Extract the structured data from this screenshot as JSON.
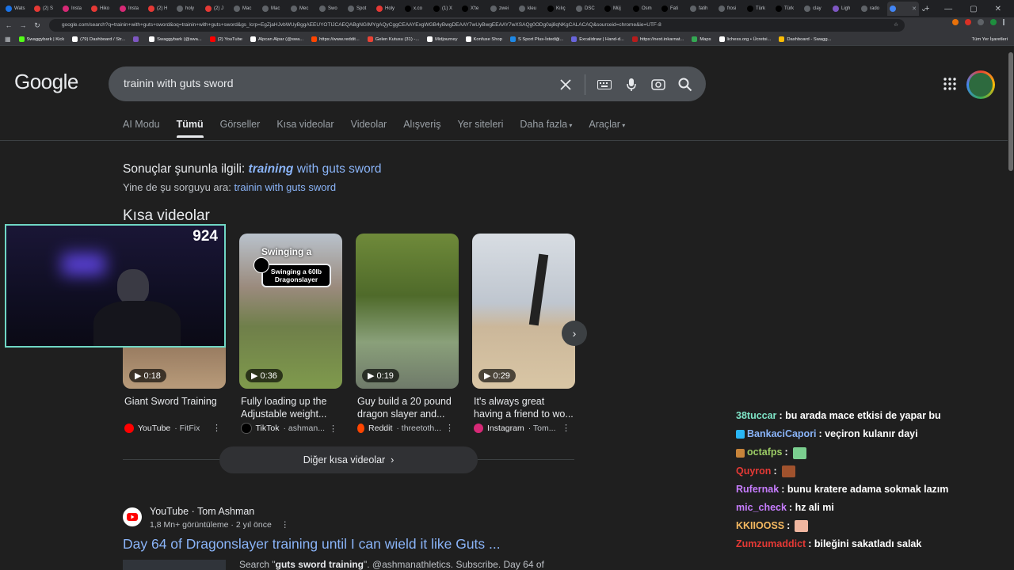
{
  "browser": {
    "tabs": [
      {
        "label": "Wats",
        "color": "#1a73e8"
      },
      {
        "label": "(2) S",
        "color": "#e53935"
      },
      {
        "label": "Insta",
        "color": "#d62976"
      },
      {
        "label": "Hiko",
        "color": "#e53935"
      },
      {
        "label": "Insta",
        "color": "#d62976"
      },
      {
        "label": "(2) H",
        "color": "#e53935"
      },
      {
        "label": "holy",
        "color": "#5f6368"
      },
      {
        "label": "(2) J",
        "color": "#e53935"
      },
      {
        "label": "Mac",
        "color": "#5f6368"
      },
      {
        "label": "Mac",
        "color": "#5f6368"
      },
      {
        "label": "Mec",
        "color": "#5f6368"
      },
      {
        "label": "Swo",
        "color": "#5f6368"
      },
      {
        "label": "Spot",
        "color": "#5f6368"
      },
      {
        "label": "Holy",
        "color": "#e53935"
      },
      {
        "label": "x.co",
        "color": "#000000"
      },
      {
        "label": "(1) X",
        "color": "#000000"
      },
      {
        "label": "X'te",
        "color": "#000000"
      },
      {
        "label": "zwei",
        "color": "#5f6368"
      },
      {
        "label": "kleu",
        "color": "#5f6368"
      },
      {
        "label": "Kılıç",
        "color": "#000000"
      },
      {
        "label": "DSC",
        "color": "#5f6368"
      },
      {
        "label": "Müj",
        "color": "#000000"
      },
      {
        "label": "Osm",
        "color": "#000000"
      },
      {
        "label": "Fati",
        "color": "#000000"
      },
      {
        "label": "fatih",
        "color": "#5f6368"
      },
      {
        "label": "frosi",
        "color": "#5f6368"
      },
      {
        "label": "Türk",
        "color": "#000000"
      },
      {
        "label": "Türk",
        "color": "#000000"
      },
      {
        "label": "clay",
        "color": "#5f6368"
      },
      {
        "label": "Ligh",
        "color": "#7e57c2"
      },
      {
        "label": "rado",
        "color": "#5f6368"
      },
      {
        "label": "",
        "color": "#4285f4",
        "active": true
      }
    ],
    "new_tab": "+",
    "url": "google.com/search?q=trainin+with+guts+sword&oq=trainin+with+guts+sword&gs_lcrp=EgZjaHJvbWUyBggAEEUYOTIJCAEQABgNGIMYgAQyCggCEAAYExgWGB4yBwgDEAAY7wUyBwgEEAAY7wXSAQg0ODg0aj8qNKgCALACAQ&sourceid=chrome&ie=UTF-8",
    "bookmarks": [
      {
        "label": "Swaggybark | Kick",
        "color": "#53fc18"
      },
      {
        "label": "(79) Dashboard / Str...",
        "color": "#ffffff"
      },
      {
        "label": "",
        "color": "#7e57c2"
      },
      {
        "label": "Swaggybark (@swa...",
        "color": "#ffffff"
      },
      {
        "label": "(2) YouTube",
        "color": "#ff0000"
      },
      {
        "label": "Alpcan Alpar (@swa...",
        "color": "#ffffff"
      },
      {
        "label": "https://www.reddit...",
        "color": "#ff4500"
      },
      {
        "label": "Gelen Kutusu (31) -...",
        "color": "#ea4335"
      },
      {
        "label": "Midjourney",
        "color": "#ffffff"
      },
      {
        "label": "Konfuse Shop",
        "color": "#ffffff"
      },
      {
        "label": "S Sport Plus-İstediği...",
        "color": "#1e88e5"
      },
      {
        "label": "Excalidraw | Hand-d...",
        "color": "#6965db"
      },
      {
        "label": "https://next.inkarnat...",
        "color": "#b71c1c"
      },
      {
        "label": "Maps",
        "color": "#34a853"
      },
      {
        "label": "lichess.org • Ücretsi...",
        "color": "#ffffff"
      },
      {
        "label": "Dashboard - Swagg...",
        "color": "#fbbc05"
      }
    ],
    "all_bookmarks": "Tüm Yer İşaretleri"
  },
  "google": {
    "logo": "Google",
    "query": "trainin with guts sword",
    "tabs": [
      "AI Modu",
      "Tümü",
      "Görseller",
      "Kısa videolar",
      "Videolar",
      "Alışveriş",
      "Yer siteleri",
      "Daha fazla",
      "Araçlar"
    ],
    "selected_tab": "Tümü",
    "spell": {
      "prefix": "Sonuçlar şununla ilgili: ",
      "corrected_bold": "training",
      "corrected_rest": " with guts sword",
      "instead_prefix": "Yine de şu sorguyu ara: ",
      "instead_link": "trainin with guts sword"
    },
    "short_videos_title": "Kısa videolar",
    "short_videos": [
      {
        "duration": "0:18",
        "title": "Giant Sword Training",
        "platform": "YouTube",
        "author": "· FitFix",
        "color": "#ff0000"
      },
      {
        "duration": "0:36",
        "title": "Fully loading up the Adjustable weight...",
        "platform": "TikTok",
        "author": "· ashman...",
        "color": "#000000"
      },
      {
        "duration": "0:19",
        "title": "Guy build a 20 pound dragon slayer and...",
        "platform": "Reddit",
        "author": "· threetoth...",
        "color": "#ff4500"
      },
      {
        "duration": "0:29",
        "title": "It's always great having a friend to wo...",
        "platform": "Instagram",
        "author": "· Tom...",
        "color": "#d62976"
      }
    ],
    "thumb2_caption_1": "Swinging a",
    "thumb2_caption_2": "Swinging a 60lb Dragonslayer",
    "more_short_videos": "Diğer kısa videolar",
    "result": {
      "source": "YouTube · Tom Ashman",
      "meta": "1,8 Mn+ görüntüleme · 2 yıl önce",
      "title": "Day 64 of Dragonslayer training until I can wield it like Guts ...",
      "snippet_pre": "Search \"",
      "snippet_bold": "guts sword training",
      "snippet_post": "\". @ashmanathletics. Subscribe. Day 64 of"
    }
  },
  "stream": {
    "viewer_count": "924",
    "chat": [
      {
        "user": "38tuccar",
        "color": "#7ee3c6",
        "msg": ": bu arada mace etkisi de yapar bu",
        "badge": ""
      },
      {
        "user": "BankaciCapori",
        "color": "#8ab4f8",
        "msg": ": veçiron kulanır dayi",
        "badge": "#29b6f6"
      },
      {
        "user": "octafps",
        "color": "#9ccc65",
        "msg": " :",
        "badge": "#c7843a",
        "emote": "#7bcf8f"
      },
      {
        "user": "Quyron",
        "color": "#e53935",
        "msg": " :",
        "badge": "",
        "emote": "#a0522d"
      },
      {
        "user": "Rufernak",
        "color": "#c77dff",
        "msg": ": bunu kratere adama sokmak lazım",
        "badge": ""
      },
      {
        "user": "mic_check",
        "color": "#c77dff",
        "msg": ": hz ali mi",
        "badge": ""
      },
      {
        "user": "KKIIOOSS",
        "color": "#f4b860",
        "msg": " :",
        "badge": "",
        "emote": "#f0b6a0"
      },
      {
        "user": "Zumzumaddict",
        "color": "#e53935",
        "msg": ": bileğini sakatladı salak",
        "badge": ""
      }
    ]
  },
  "colors": {
    "link": "#8ab4f8",
    "bg": "#1f1f1f",
    "cam_border": "#6fd6c4"
  }
}
